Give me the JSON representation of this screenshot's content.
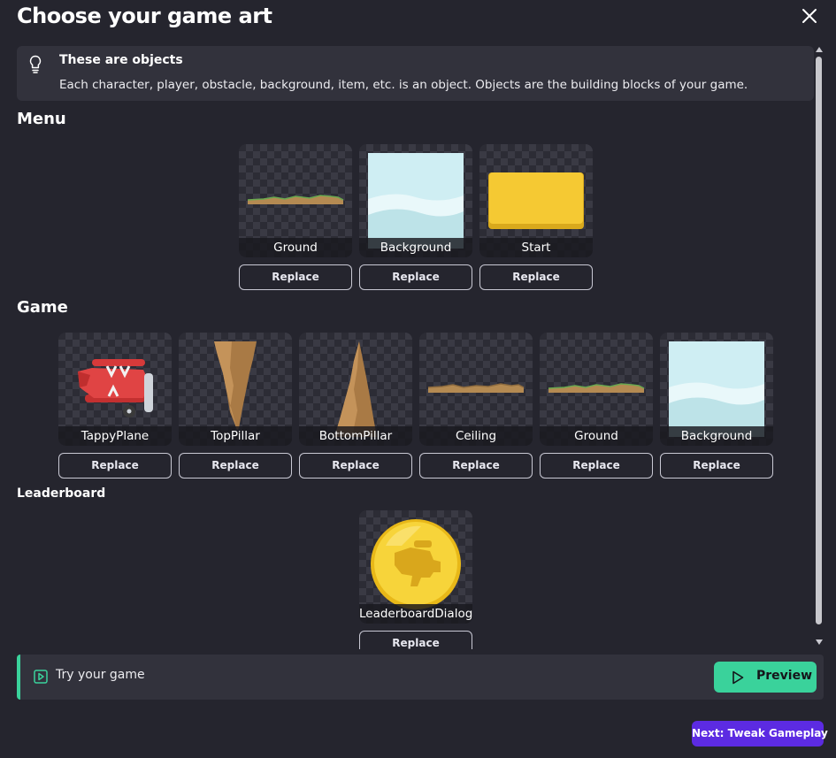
{
  "dialog": {
    "title": "Choose your game art",
    "close_icon": "close-icon"
  },
  "info": {
    "icon": "lightbulb-icon",
    "title": "These are objects",
    "text": "Each character, player, obstacle, background, item, etc. is an object. Objects are the building blocks of your game."
  },
  "sections": {
    "menu": {
      "heading": "Menu",
      "items": [
        {
          "label": "Ground",
          "replace": "Replace",
          "art": "ground"
        },
        {
          "label": "Background",
          "replace": "Replace",
          "art": "background"
        },
        {
          "label": "Start",
          "replace": "Replace",
          "art": "start-button"
        }
      ]
    },
    "game": {
      "heading": "Game",
      "items": [
        {
          "label": "TappyPlane",
          "replace": "Replace",
          "art": "red-plane"
        },
        {
          "label": "TopPillar",
          "replace": "Replace",
          "art": "top-pillar"
        },
        {
          "label": "BottomPillar",
          "replace": "Replace",
          "art": "bottom-pillar"
        },
        {
          "label": "Ceiling",
          "replace": "Replace",
          "art": "ceiling"
        },
        {
          "label": "Ground",
          "replace": "Replace",
          "art": "ground"
        },
        {
          "label": "Background",
          "replace": "Replace",
          "art": "background"
        }
      ]
    },
    "leaderboard": {
      "heading": "Leaderboard",
      "items": [
        {
          "label": "LeaderboardDialog",
          "replace": "Replace",
          "art": "gold-medal"
        }
      ]
    }
  },
  "try_bar": {
    "icon": "play-square-icon",
    "text": "Try your game",
    "preview_label": "Preview",
    "preview_icon": "play-icon"
  },
  "next_button": {
    "label": "Next: Tweak Gameplay"
  },
  "colors": {
    "background": "#25252e",
    "panel": "#32323c",
    "accent_green": "#3ad29b",
    "accent_purple": "#5c2be2"
  }
}
